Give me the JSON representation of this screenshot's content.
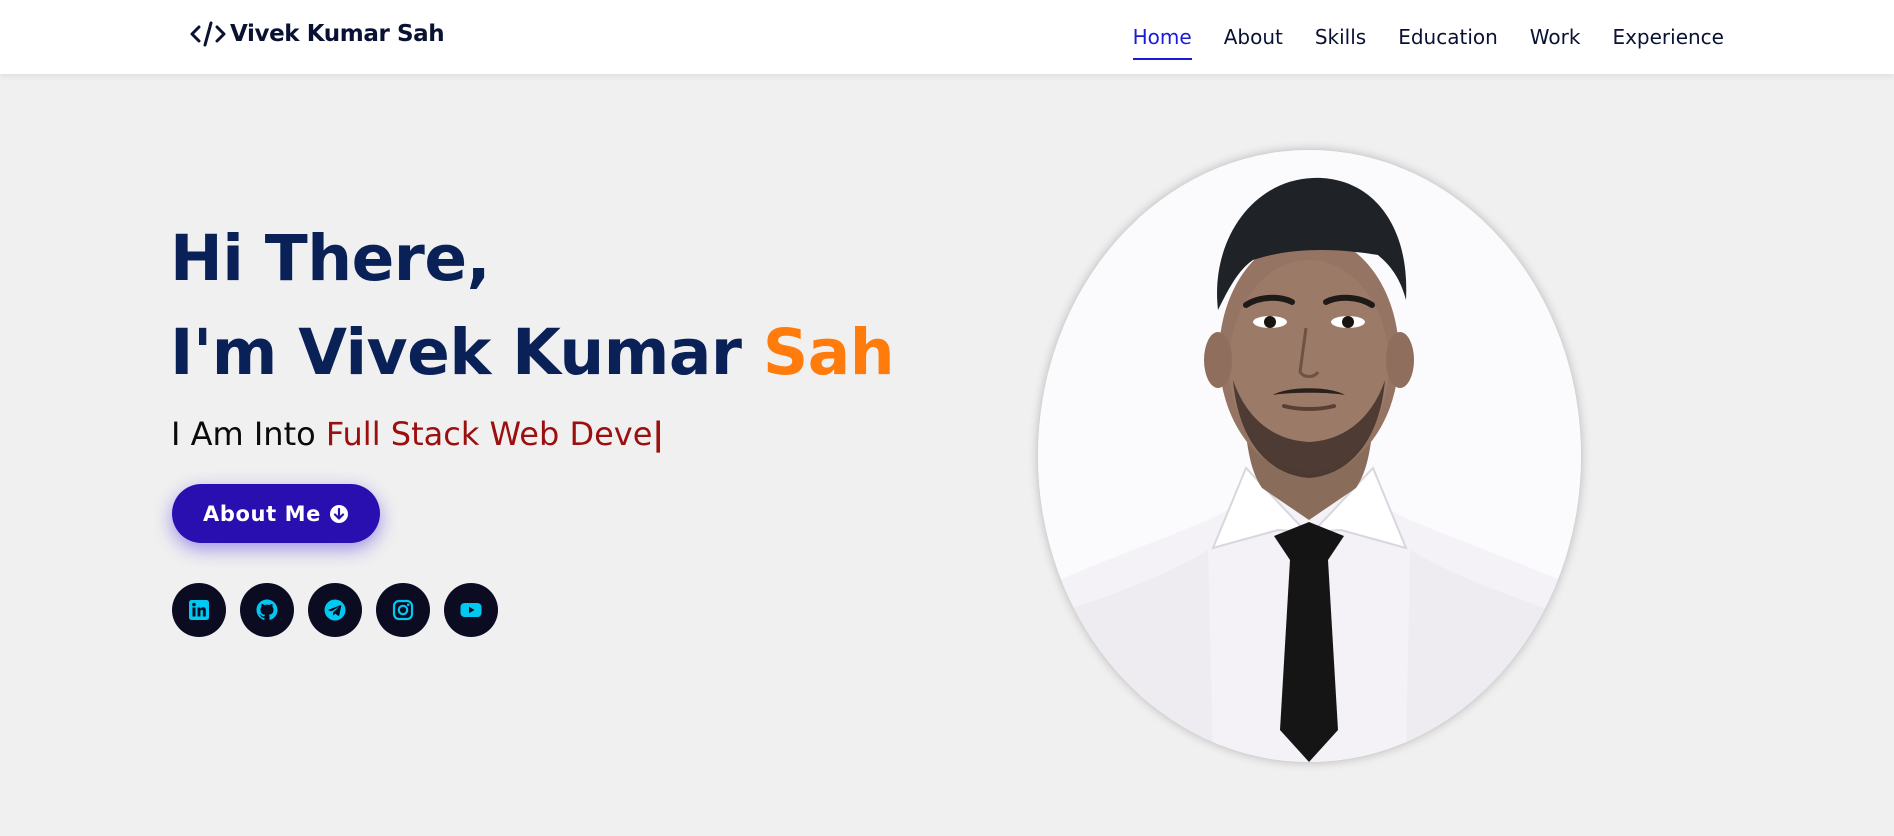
{
  "header": {
    "brand_icon": "code-icon",
    "brand_name": "Vivek Kumar Sah",
    "nav": [
      {
        "label": "Home",
        "active": true
      },
      {
        "label": "About"
      },
      {
        "label": "Skills"
      },
      {
        "label": "Education"
      },
      {
        "label": "Work"
      },
      {
        "label": "Experience"
      }
    ]
  },
  "hero": {
    "greeting": "Hi There,",
    "intro_prefix": "I'm Vivek Kumar",
    "intro_accent": "Sah",
    "sub_prefix": "I Am Into",
    "sub_typed": "Full Stack Web Deve",
    "sub_caret": "|",
    "about_button": {
      "label": "About Me",
      "icon": "arrow-circle-down-icon"
    },
    "socials": [
      {
        "name": "linkedin",
        "icon": "linkedin-icon"
      },
      {
        "name": "github",
        "icon": "github-icon"
      },
      {
        "name": "telegram",
        "icon": "telegram-icon"
      },
      {
        "name": "instagram",
        "icon": "instagram-icon"
      },
      {
        "name": "youtube",
        "icon": "youtube-icon"
      }
    ],
    "photo": "profile-photo"
  },
  "colors": {
    "background": "#f0f0f0",
    "heading": "#0a2158",
    "accent_orange": "#ff7b0c",
    "typed_text": "#9b0f0f",
    "button": "#2a0fb0",
    "nav_active": "#1a1adb",
    "social_bg": "#0b0b22",
    "social_icon": "#00c8f0"
  }
}
